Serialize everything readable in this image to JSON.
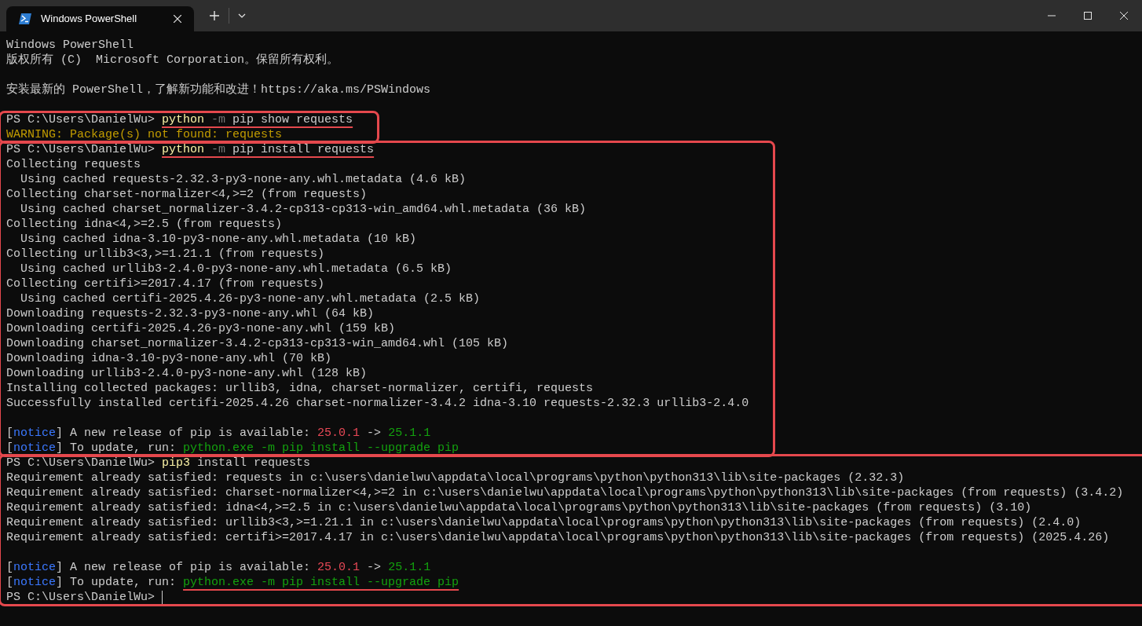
{
  "window": {
    "tabs": [
      {
        "title": "Windows PowerShell",
        "selected": true
      }
    ]
  },
  "blocks": [
    {
      "boxed": false,
      "lines": [
        {
          "kind": "output",
          "segments": [
            {
              "t": "Windows PowerShell",
              "kind": "text"
            }
          ]
        },
        {
          "kind": "output",
          "segments": [
            {
              "t": "版权所有 (C)  Microsoft Corporation。保留所有权利。",
              "kind": "text"
            }
          ]
        },
        {
          "kind": "blank"
        },
        {
          "kind": "output",
          "segments": [
            {
              "t": "安装最新的 PowerShell，了解新功能和改进！https://aka.ms/PSWindows",
              "kind": "text"
            }
          ]
        },
        {
          "kind": "blank"
        }
      ]
    },
    {
      "boxed": true,
      "lines": [
        {
          "kind": "output",
          "segments": [
            {
              "t": "PS C:\\Users\\DanielWu> ",
              "kind": "text"
            },
            {
              "t": "python",
              "kind": "command",
              "underlined": true
            },
            {
              "t": " -m",
              "kind": "flag",
              "underlined": true
            },
            {
              "t": " pip show requests",
              "kind": "text",
              "underlined": true
            }
          ]
        },
        {
          "kind": "output",
          "segments": [
            {
              "t": "WARNING: Package(s) not found: requests",
              "kind": "warning"
            }
          ]
        }
      ]
    },
    {
      "boxed": true,
      "lines": [
        {
          "kind": "output",
          "segments": [
            {
              "t": "PS C:\\Users\\DanielWu> ",
              "kind": "text"
            },
            {
              "t": "python",
              "kind": "command",
              "underlined": true
            },
            {
              "t": " -m",
              "kind": "flag",
              "underlined": true
            },
            {
              "t": " pip install requests",
              "kind": "text",
              "underlined": true
            }
          ]
        },
        {
          "kind": "output",
          "segments": [
            {
              "t": "Collecting requests",
              "kind": "text"
            }
          ]
        },
        {
          "kind": "output",
          "segments": [
            {
              "t": "  Using cached requests-2.32.3-py3-none-any.whl.metadata (4.6 kB)",
              "kind": "text"
            }
          ]
        },
        {
          "kind": "output",
          "segments": [
            {
              "t": "Collecting charset-normalizer<4,>=2 (from requests)",
              "kind": "text"
            }
          ]
        },
        {
          "kind": "output",
          "segments": [
            {
              "t": "  Using cached charset_normalizer-3.4.2-cp313-cp313-win_amd64.whl.metadata (36 kB)",
              "kind": "text"
            }
          ]
        },
        {
          "kind": "output",
          "segments": [
            {
              "t": "Collecting idna<4,>=2.5 (from requests)",
              "kind": "text"
            }
          ]
        },
        {
          "kind": "output",
          "segments": [
            {
              "t": "  Using cached idna-3.10-py3-none-any.whl.metadata (10 kB)",
              "kind": "text"
            }
          ]
        },
        {
          "kind": "output",
          "segments": [
            {
              "t": "Collecting urllib3<3,>=1.21.1 (from requests)",
              "kind": "text"
            }
          ]
        },
        {
          "kind": "output",
          "segments": [
            {
              "t": "  Using cached urllib3-2.4.0-py3-none-any.whl.metadata (6.5 kB)",
              "kind": "text"
            }
          ]
        },
        {
          "kind": "output",
          "segments": [
            {
              "t": "Collecting certifi>=2017.4.17 (from requests)",
              "kind": "text"
            }
          ]
        },
        {
          "kind": "output",
          "segments": [
            {
              "t": "  Using cached certifi-2025.4.26-py3-none-any.whl.metadata (2.5 kB)",
              "kind": "text"
            }
          ]
        },
        {
          "kind": "output",
          "segments": [
            {
              "t": "Downloading requests-2.32.3-py3-none-any.whl (64 kB)",
              "kind": "text"
            }
          ]
        },
        {
          "kind": "output",
          "segments": [
            {
              "t": "Downloading certifi-2025.4.26-py3-none-any.whl (159 kB)",
              "kind": "text"
            }
          ]
        },
        {
          "kind": "output",
          "segments": [
            {
              "t": "Downloading charset_normalizer-3.4.2-cp313-cp313-win_amd64.whl (105 kB)",
              "kind": "text"
            }
          ]
        },
        {
          "kind": "output",
          "segments": [
            {
              "t": "Downloading idna-3.10-py3-none-any.whl (70 kB)",
              "kind": "text"
            }
          ]
        },
        {
          "kind": "output",
          "segments": [
            {
              "t": "Downloading urllib3-2.4.0-py3-none-any.whl (128 kB)",
              "kind": "text"
            }
          ]
        },
        {
          "kind": "output",
          "segments": [
            {
              "t": "Installing collected packages: urllib3, idna, charset-normalizer, certifi, requests",
              "kind": "text"
            }
          ]
        },
        {
          "kind": "output",
          "segments": [
            {
              "t": "Successfully installed certifi-2025.4.26 charset-normalizer-3.4.2 idna-3.10 requests-2.32.3 urllib3-2.4.0",
              "kind": "text"
            }
          ]
        },
        {
          "kind": "blank"
        },
        {
          "kind": "output",
          "segments": [
            {
              "t": "[",
              "kind": "text"
            },
            {
              "t": "notice",
              "kind": "notice"
            },
            {
              "t": "] A new release of pip is available: ",
              "kind": "text"
            },
            {
              "t": "25.0.1",
              "kind": "old"
            },
            {
              "t": " -> ",
              "kind": "text"
            },
            {
              "t": "25.1.1",
              "kind": "new"
            }
          ]
        },
        {
          "kind": "output",
          "segments": [
            {
              "t": "[",
              "kind": "text"
            },
            {
              "t": "notice",
              "kind": "notice"
            },
            {
              "t": "] To update, run: ",
              "kind": "text"
            },
            {
              "t": "python.exe -m pip install --upgrade pip",
              "kind": "new"
            }
          ]
        }
      ]
    },
    {
      "boxed": true,
      "lines": [
        {
          "kind": "output",
          "segments": [
            {
              "t": "PS C:\\Users\\DanielWu> ",
              "kind": "text"
            },
            {
              "t": "pip3",
              "kind": "command"
            },
            {
              "t": " install requests",
              "kind": "text"
            }
          ]
        },
        {
          "kind": "output",
          "segments": [
            {
              "t": "Requirement already satisfied: requests in c:\\users\\danielwu\\appdata\\local\\programs\\python\\python313\\lib\\site-packages (2.32.3)",
              "kind": "text"
            }
          ]
        },
        {
          "kind": "output",
          "segments": [
            {
              "t": "Requirement already satisfied: charset-normalizer<4,>=2 in c:\\users\\danielwu\\appdata\\local\\programs\\python\\python313\\lib\\site-packages (from requests) (3.4.2)",
              "kind": "text"
            }
          ]
        },
        {
          "kind": "output",
          "segments": [
            {
              "t": "Requirement already satisfied: idna<4,>=2.5 in c:\\users\\danielwu\\appdata\\local\\programs\\python\\python313\\lib\\site-packages (from requests) (3.10)",
              "kind": "text"
            }
          ]
        },
        {
          "kind": "output",
          "segments": [
            {
              "t": "Requirement already satisfied: urllib3<3,>=1.21.1 in c:\\users\\danielwu\\appdata\\local\\programs\\python\\python313\\lib\\site-packages (from requests) (2.4.0)",
              "kind": "text"
            }
          ]
        },
        {
          "kind": "output",
          "segments": [
            {
              "t": "Requirement already satisfied: certifi>=2017.4.17 in c:\\users\\danielwu\\appdata\\local\\programs\\python\\python313\\lib\\site-packages (from requests) (2025.4.26)",
              "kind": "text"
            }
          ]
        },
        {
          "kind": "blank"
        },
        {
          "kind": "output",
          "segments": [
            {
              "t": "[",
              "kind": "text"
            },
            {
              "t": "notice",
              "kind": "notice"
            },
            {
              "t": "] A new release of pip is available: ",
              "kind": "text"
            },
            {
              "t": "25.0.1",
              "kind": "old"
            },
            {
              "t": " -> ",
              "kind": "text"
            },
            {
              "t": "25.1.1",
              "kind": "new"
            }
          ]
        },
        {
          "kind": "output",
          "segments": [
            {
              "t": "[",
              "kind": "text"
            },
            {
              "t": "notice",
              "kind": "notice"
            },
            {
              "t": "] To update, run: ",
              "kind": "text"
            },
            {
              "t": "python.exe -m pip install --upgrade pip",
              "kind": "new",
              "underlined": true
            }
          ]
        },
        {
          "kind": "output",
          "segments": [
            {
              "t": "PS C:\\Users\\DanielWu> ",
              "kind": "text"
            }
          ],
          "cursor": true
        }
      ]
    }
  ]
}
